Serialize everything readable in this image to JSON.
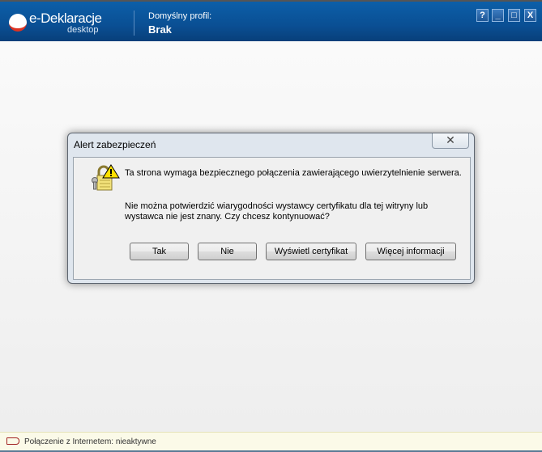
{
  "app": {
    "logo_title": "e-Deklaracje",
    "logo_subtitle": "desktop",
    "profile_label": "Domyślny profil:",
    "profile_value": "Brak"
  },
  "window_buttons": {
    "help": "?",
    "minimize": "_",
    "maximize": "□",
    "close": "X"
  },
  "dialog": {
    "title": "Alert zabezpieczeń",
    "close": "✕",
    "message1": "Ta strona wymaga bezpiecznego połączenia zawierającego uwierzytelnienie serwera.",
    "message2": "Nie można potwierdzić wiarygodności wystawcy certyfikatu dla tej witryny lub wystawca nie jest znany. Czy chcesz kontynuować?",
    "buttons": [
      "Tak",
      "Nie",
      "Wyświetl certyfikat",
      "Więcej informacji"
    ]
  },
  "status": {
    "text": "Połączenie z Internetem: nieaktywne",
    "color": "#a02020"
  }
}
